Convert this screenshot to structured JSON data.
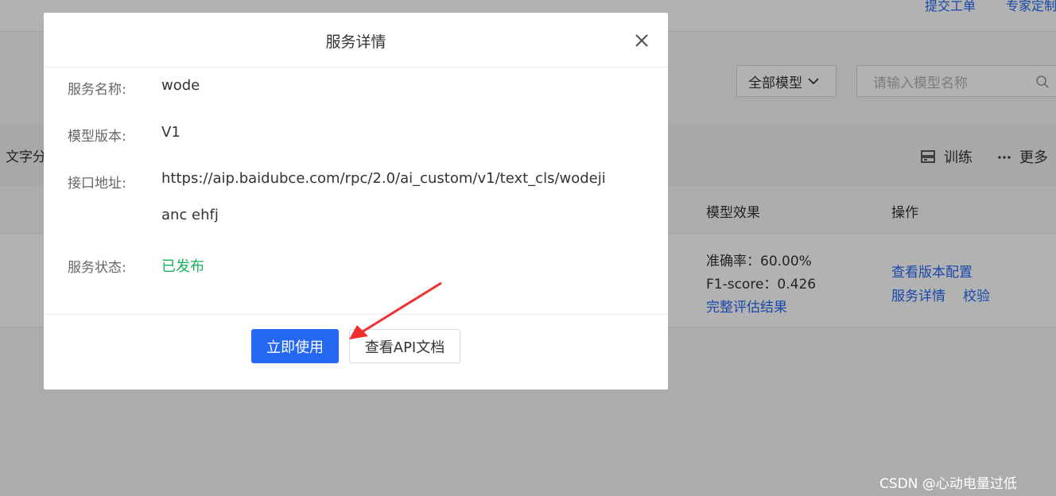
{
  "header": {
    "links": [
      "提交工单",
      "专家定制"
    ]
  },
  "toolbar": {
    "model_filter": "全部模型",
    "search_placeholder": "请输入模型名称"
  },
  "model_bar": {
    "name": "文字分",
    "actions": [
      "训练",
      "更多"
    ]
  },
  "table": {
    "headers": [
      "模型效果",
      "操作"
    ],
    "row": {
      "accuracy": "准确率：60.00%",
      "f1": "F1-score：0.426",
      "full_eval_link": "完整评估结果",
      "operations": [
        "查看版本配置",
        "服务详情",
        "校验"
      ]
    }
  },
  "modal": {
    "title": "服务详情",
    "fields": [
      {
        "label": "服务名称:",
        "value": "wode"
      },
      {
        "label": "模型版本:",
        "value": "V1"
      },
      {
        "label": "接口地址:",
        "value": "https://aip.baidubce.com/rpc/2.0/ai_custom/v1/text_cls/wodejianc ehfj"
      },
      {
        "label": "服务状态:",
        "value": "已发布"
      }
    ],
    "primary_button": "立即使用",
    "secondary_button": "查看API文档"
  },
  "watermark": "CSDN @心动电量过低",
  "colors": {
    "primary": "#2468f2",
    "status_published": "#18b05a",
    "annotation_arrow": "#f03030"
  }
}
